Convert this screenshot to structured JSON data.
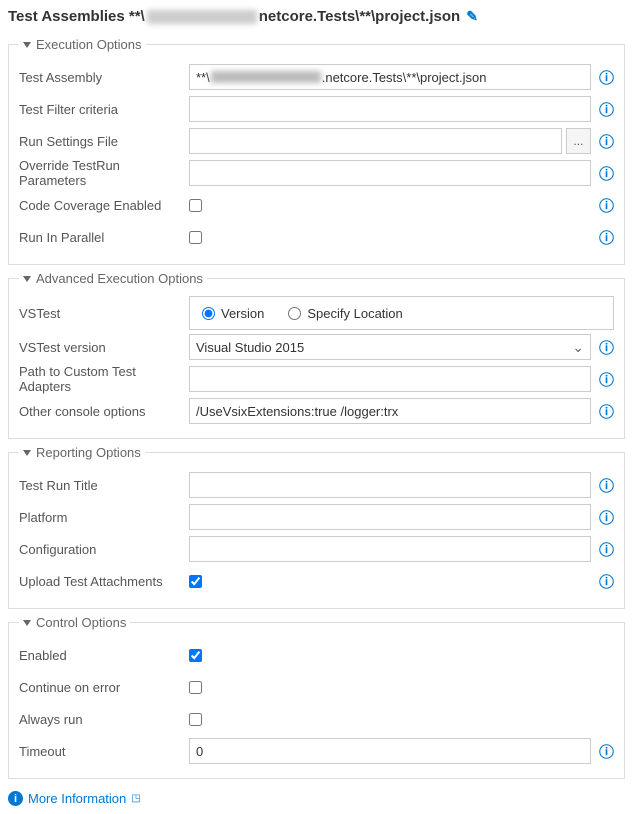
{
  "title_prefix": "Test Assemblies **\\",
  "title_suffix": "netcore.Tests\\**\\project.json",
  "sections": {
    "exec": "Execution Options",
    "adv": "Advanced Execution Options",
    "report": "Reporting Options",
    "control": "Control Options"
  },
  "labels": {
    "test_assembly": "Test Assembly",
    "test_filter": "Test Filter criteria",
    "run_settings": "Run Settings File",
    "override_params": "Override TestRun Parameters",
    "code_coverage": "Code Coverage Enabled",
    "run_parallel": "Run In Parallel",
    "vstest": "VSTest",
    "vstest_version": "VSTest version",
    "path_adapters": "Path to Custom Test Adapters",
    "other_console": "Other console options",
    "test_run_title": "Test Run Title",
    "platform": "Platform",
    "configuration": "Configuration",
    "upload_attach": "Upload Test Attachments",
    "enabled": "Enabled",
    "continue_err": "Continue on error",
    "always_run": "Always run",
    "timeout": "Timeout"
  },
  "values": {
    "test_assembly_prefix": "**\\",
    "test_assembly_suffix": ".netcore.Tests\\**\\project.json",
    "vstest_version_selected": "Visual Studio 2015",
    "other_console": "/UseVsixExtensions:true /logger:trx",
    "timeout": "0"
  },
  "radio": {
    "version": "Version",
    "specify": "Specify Location"
  },
  "more_info": "More Information"
}
